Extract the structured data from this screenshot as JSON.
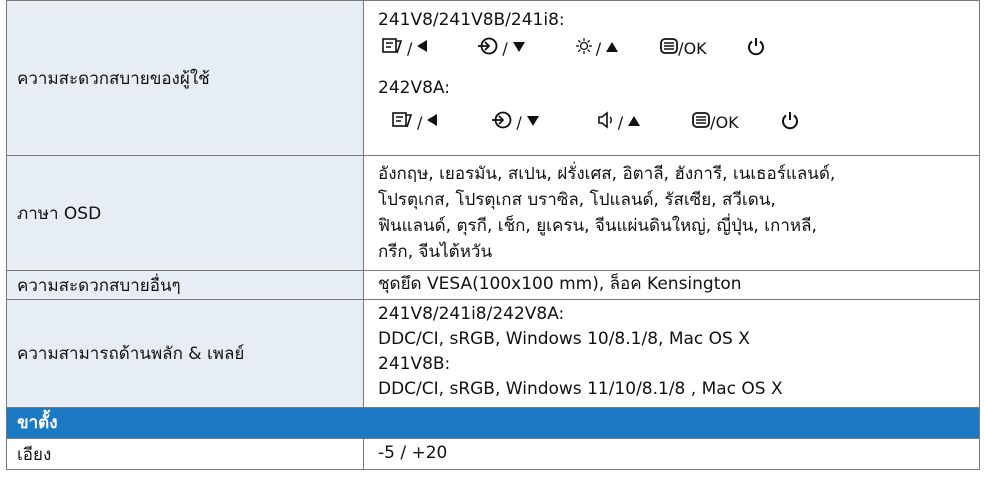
{
  "rows": {
    "convenience": {
      "label": "ความสะดวกสบายของผู้ใช้",
      "model_a": "241V8/241V8B/241i8:",
      "model_b": "242V8A:",
      "ok": "/OK"
    },
    "osd": {
      "label": "ภาษา OSD",
      "lines": [
        "อังกฤษ, เยอรมัน, สเปน, ฝรั่งเศส, อิตาลี, ฮังการี, เนเธอร์แลนด์,",
        "โปรตุเกส, โปรตุเกส บราซิล, โปแลนด์, รัสเซีย, สวีเดน,",
        "ฟินแลนด์, ตุรกี, เช็ก, ยูเครน, จีนแผ่นดินใหญ่, ญี่ปุ่น, เกาหลี,",
        "กรีก, จีนไต้หวัน"
      ]
    },
    "other": {
      "label": "ความสะดวกสบายอื่นๆ",
      "value": "ชุดยึด VESA(100x100 mm), ล็อค Kensington"
    },
    "compat": {
      "label": "ความสามารถด้านพลัก & เพลย์",
      "lines": [
        "241V8/241i8/242V8A:",
        "DDC/CI, sRGB, Windows 10/8.1/8, Mac OS X",
        "241V8B:",
        "DDC/CI, sRGB, Windows 11/10/8.1/8 , Mac OS X"
      ]
    }
  },
  "section": {
    "title": "ขาตั้ง"
  },
  "tilt": {
    "label": "เอียง",
    "value": "-5 / +20"
  },
  "icons": [
    "menu-return-icon",
    "left-triangle-icon",
    "input-source-icon",
    "down-triangle-icon",
    "brightness-icon",
    "volume-icon",
    "up-triangle-icon",
    "menu-icon",
    "power-icon"
  ]
}
